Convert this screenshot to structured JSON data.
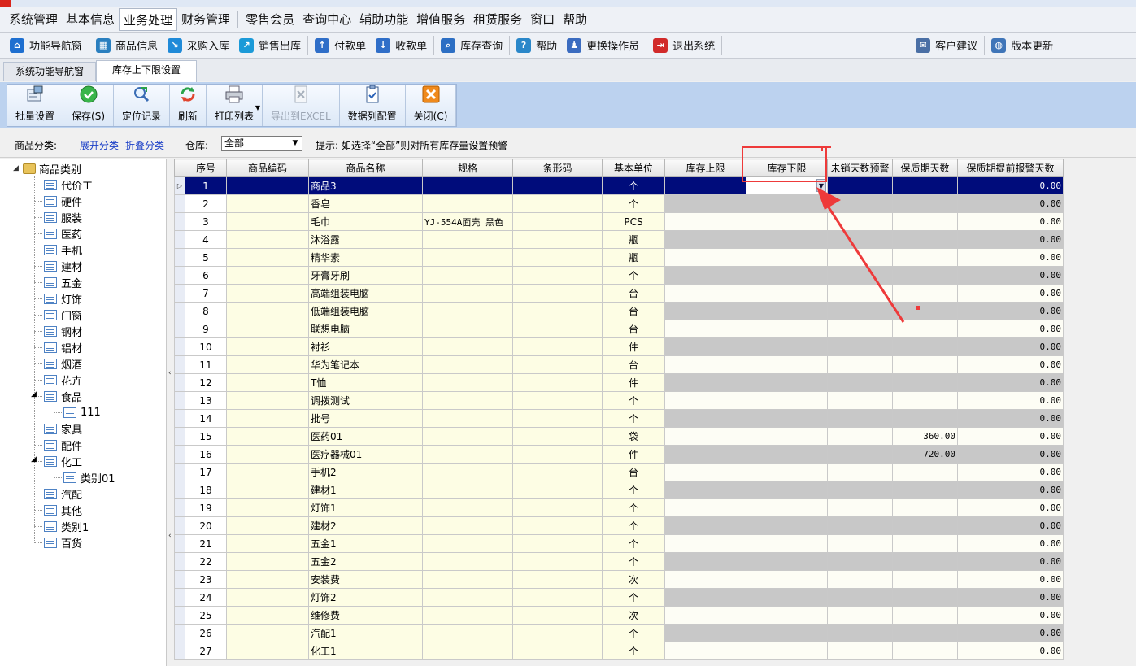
{
  "menu": [
    "系统管理",
    "基本信息",
    "业务处理",
    "财务管理",
    "零售会员",
    "查询中心",
    "辅助功能",
    "增值服务",
    "租赁服务",
    "窗口",
    "帮助"
  ],
  "menu_active": "业务处理",
  "quick": [
    {
      "label": "功能导航窗",
      "icon": "home-icon",
      "color": "#1e6fd0"
    },
    {
      "label": "商品信息",
      "icon": "product-icon",
      "color": "#2a7fbf"
    },
    {
      "label": "采购入库",
      "icon": "purchase-icon",
      "color": "#1f8ad8"
    },
    {
      "label": "销售出库",
      "icon": "sales-icon",
      "color": "#1b9ad8"
    },
    {
      "label": "付款单",
      "icon": "payment-icon",
      "color": "#2f6ec8"
    },
    {
      "label": "收款单",
      "icon": "receipt-icon",
      "color": "#2f6ec8"
    },
    {
      "label": "库存查询",
      "icon": "search-icon",
      "color": "#2d6fc4"
    },
    {
      "label": "帮助",
      "icon": "help-icon",
      "color": "#2a87c9"
    },
    {
      "label": "更换操作员",
      "icon": "user-switch-icon",
      "color": "#3b6cc0"
    },
    {
      "label": "退出系统",
      "icon": "exit-icon",
      "color": "#d12a2a"
    },
    {
      "label": "客户建议",
      "icon": "feedback-icon",
      "color": "#4a6fa5"
    },
    {
      "label": "版本更新",
      "icon": "globe-icon",
      "color": "#3f75b8"
    }
  ],
  "tabs": [
    "系统功能导航窗",
    "库存上下限设置"
  ],
  "ribbon": [
    {
      "label": "批量设置",
      "icon": "batch-settings-icon",
      "disabled": false
    },
    {
      "label": "保存(S)",
      "icon": "save-check-icon",
      "disabled": false
    },
    {
      "label": "定位记录",
      "icon": "locate-icon",
      "disabled": false
    },
    {
      "label": "刷新",
      "icon": "refresh-icon",
      "disabled": false
    },
    {
      "label": "打印列表",
      "icon": "printer-icon",
      "disabled": false
    },
    {
      "label": "导出到EXCEL",
      "icon": "excel-export-icon",
      "disabled": true
    },
    {
      "label": "数据列配置",
      "icon": "column-config-icon",
      "disabled": false
    },
    {
      "label": "关闭(C)",
      "icon": "close-icon",
      "disabled": false
    }
  ],
  "filter": {
    "category_label": "商品分类:",
    "expand": "展开分类",
    "collapse": "折叠分类",
    "warehouse_label": "仓库:",
    "warehouse_value": "全部",
    "hint": "提示: 如选择“全部”则对所有库存量设置预警"
  },
  "tree": {
    "root": "商品类别",
    "items": [
      {
        "label": "代价工",
        "level": 1
      },
      {
        "label": "硬件",
        "level": 1
      },
      {
        "label": "服装",
        "level": 1
      },
      {
        "label": "医药",
        "level": 1
      },
      {
        "label": "手机",
        "level": 1
      },
      {
        "label": "建材",
        "level": 1
      },
      {
        "label": "五金",
        "level": 1
      },
      {
        "label": "灯饰",
        "level": 1
      },
      {
        "label": "门窗",
        "level": 1
      },
      {
        "label": "钢材",
        "level": 1
      },
      {
        "label": "铝材",
        "level": 1
      },
      {
        "label": "烟酒",
        "level": 1
      },
      {
        "label": "花卉",
        "level": 1
      },
      {
        "label": "食品",
        "level": 1,
        "expanded": true
      },
      {
        "label": "111",
        "level": 2
      },
      {
        "label": "家具",
        "level": 1
      },
      {
        "label": "配件",
        "level": 1
      },
      {
        "label": "化工",
        "level": 1,
        "expanded": true
      },
      {
        "label": "类别01",
        "level": 2
      },
      {
        "label": "汽配",
        "level": 1
      },
      {
        "label": "其他",
        "level": 1
      },
      {
        "label": "类别1",
        "level": 1
      },
      {
        "label": "百货",
        "level": 1
      }
    ]
  },
  "grid": {
    "columns": [
      "序号",
      "商品编码",
      "商品名称",
      "规格",
      "条形码",
      "基本单位",
      "库存上限",
      "库存下限",
      "未销天数预警",
      "保质期天数",
      "保质期提前报警天数"
    ],
    "rows": [
      {
        "seq": "1",
        "name": "商品3",
        "spec": "",
        "unit": "个",
        "shelf": "",
        "warn": "0.00"
      },
      {
        "seq": "2",
        "name": "香皂",
        "spec": "",
        "unit": "个",
        "shelf": "",
        "warn": "0.00"
      },
      {
        "seq": "3",
        "name": "毛巾",
        "spec": "YJ-554A面壳 黑色",
        "unit": "PCS",
        "shelf": "",
        "warn": "0.00"
      },
      {
        "seq": "4",
        "name": "沐浴露",
        "spec": "",
        "unit": "瓶",
        "shelf": "",
        "warn": "0.00"
      },
      {
        "seq": "5",
        "name": "精华素",
        "spec": "",
        "unit": "瓶",
        "shelf": "",
        "warn": "0.00"
      },
      {
        "seq": "6",
        "name": "牙膏牙刷",
        "spec": "",
        "unit": "个",
        "shelf": "",
        "warn": "0.00"
      },
      {
        "seq": "7",
        "name": "高端组装电脑",
        "spec": "",
        "unit": "台",
        "shelf": "",
        "warn": "0.00"
      },
      {
        "seq": "8",
        "name": "低端组装电脑",
        "spec": "",
        "unit": "台",
        "shelf": "",
        "warn": "0.00"
      },
      {
        "seq": "9",
        "name": "联想电脑",
        "spec": "",
        "unit": "台",
        "shelf": "",
        "warn": "0.00"
      },
      {
        "seq": "10",
        "name": "衬衫",
        "spec": "",
        "unit": "件",
        "shelf": "",
        "warn": "0.00"
      },
      {
        "seq": "11",
        "name": "华为笔记本",
        "spec": "",
        "unit": "台",
        "shelf": "",
        "warn": "0.00"
      },
      {
        "seq": "12",
        "name": "T恤",
        "spec": "",
        "unit": "件",
        "shelf": "",
        "warn": "0.00"
      },
      {
        "seq": "13",
        "name": "调拨测试",
        "spec": "",
        "unit": "个",
        "shelf": "",
        "warn": "0.00"
      },
      {
        "seq": "14",
        "name": "批号",
        "spec": "",
        "unit": "个",
        "shelf": "",
        "warn": "0.00"
      },
      {
        "seq": "15",
        "name": "医药01",
        "spec": "",
        "unit": "袋",
        "shelf": "360.00",
        "warn": "0.00"
      },
      {
        "seq": "16",
        "name": "医疗器械01",
        "spec": "",
        "unit": "件",
        "shelf": "720.00",
        "warn": "0.00"
      },
      {
        "seq": "17",
        "name": "手机2",
        "spec": "",
        "unit": "台",
        "shelf": "",
        "warn": "0.00"
      },
      {
        "seq": "18",
        "name": "建材1",
        "spec": "",
        "unit": "个",
        "shelf": "",
        "warn": "0.00"
      },
      {
        "seq": "19",
        "name": "灯饰1",
        "spec": "",
        "unit": "个",
        "shelf": "",
        "warn": "0.00"
      },
      {
        "seq": "20",
        "name": "建材2",
        "spec": "",
        "unit": "个",
        "shelf": "",
        "warn": "0.00"
      },
      {
        "seq": "21",
        "name": "五金1",
        "spec": "",
        "unit": "个",
        "shelf": "",
        "warn": "0.00"
      },
      {
        "seq": "22",
        "name": "五金2",
        "spec": "",
        "unit": "个",
        "shelf": "",
        "warn": "0.00"
      },
      {
        "seq": "23",
        "name": "安装费",
        "spec": "",
        "unit": "次",
        "shelf": "",
        "warn": "0.00"
      },
      {
        "seq": "24",
        "name": "灯饰2",
        "spec": "",
        "unit": "个",
        "shelf": "",
        "warn": "0.00"
      },
      {
        "seq": "25",
        "name": "维修费",
        "spec": "",
        "unit": "次",
        "shelf": "",
        "warn": "0.00"
      },
      {
        "seq": "26",
        "name": "汽配1",
        "spec": "",
        "unit": "个",
        "shelf": "",
        "warn": "0.00"
      },
      {
        "seq": "27",
        "name": "化工1",
        "spec": "",
        "unit": "个",
        "shelf": "",
        "warn": "0.00"
      }
    ]
  },
  "colors": {
    "selection": "#000c7b",
    "annotation": "#ee3a3a",
    "ribbon": "#bcd2ef",
    "editable": "#fdfde4",
    "locked": "#c8c8c8"
  }
}
